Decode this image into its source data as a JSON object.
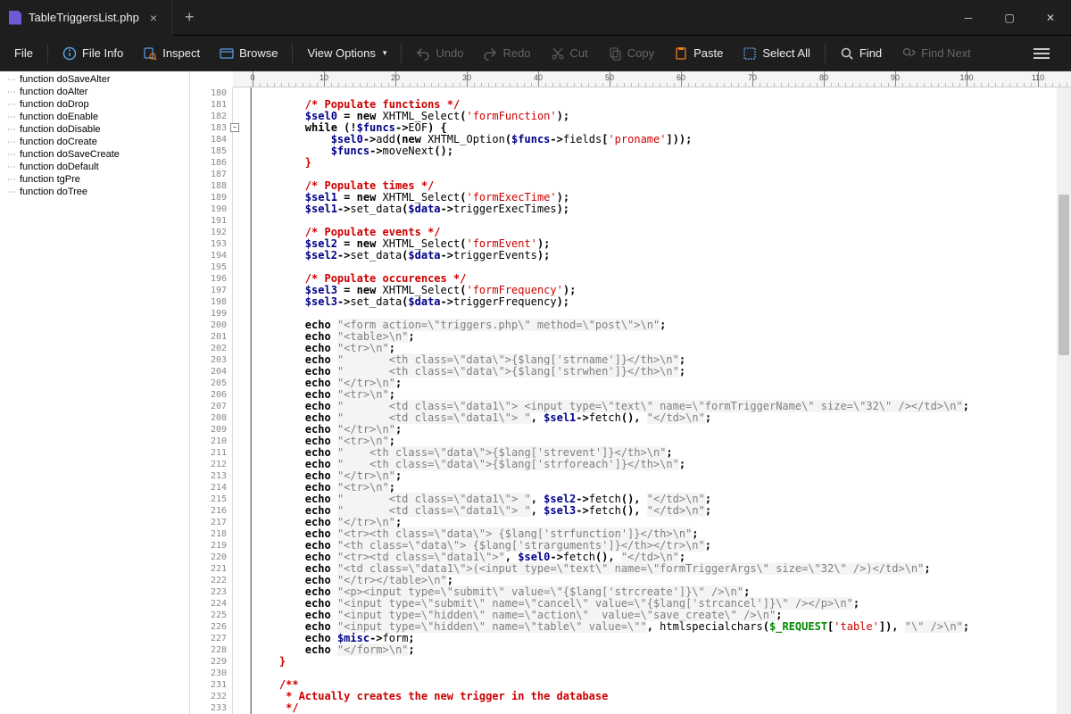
{
  "tab": {
    "title": "TableTriggersList.php"
  },
  "toolbar": {
    "file": "File",
    "file_info": "File Info",
    "inspect": "Inspect",
    "browse": "Browse",
    "view_options": "View Options",
    "undo": "Undo",
    "redo": "Redo",
    "cut": "Cut",
    "copy": "Copy",
    "paste": "Paste",
    "select_all": "Select All",
    "find": "Find",
    "find_next": "Find Next"
  },
  "outline": [
    "function doSaveAlter",
    "function doAlter",
    "function doDrop",
    "function doEnable",
    "function doDisable",
    "function doCreate",
    "function doSaveCreate",
    "function doDefault",
    "function tgPre",
    "function doTree"
  ],
  "ruler": {
    "start": 0,
    "step": 10,
    "count": 12,
    "charWidth": 8
  },
  "code": {
    "first_line": 180,
    "lines": [
      {
        "i": 180,
        "t": ""
      },
      {
        "i": 181,
        "t": "        /* Populate functions */",
        "cls": "cm"
      },
      {
        "i": 182,
        "h": "        <span class='vr'>$sel0</span> <span class='op'>=</span> <span class='kw'>new</span> XHTML_Select<span class='op'>(</span><span class='sq'>'formFunction'</span><span class='op'>);</span>"
      },
      {
        "i": 183,
        "h": "        <span class='kw'>while</span> <span class='op'>(!</span><span class='vr'>$funcs</span><span class='op'>-&gt;</span>EOF<span class='op'>) {</span>",
        "fold": true
      },
      {
        "i": 184,
        "h": "            <span class='vr'>$sel0</span><span class='op'>-&gt;</span>add<span class='op'>(</span><span class='kw'>new</span> XHTML_Option<span class='op'>(</span><span class='vr'>$funcs</span><span class='op'>-&gt;</span>fields<span class='op'>[</span><span class='sq'>'proname'</span><span class='op'>]));</span>"
      },
      {
        "i": 185,
        "h": "            <span class='vr'>$funcs</span><span class='op'>-&gt;</span>moveNext<span class='op'>();</span>"
      },
      {
        "i": 186,
        "h": "        <span class='br'>}</span>"
      },
      {
        "i": 187,
        "t": ""
      },
      {
        "i": 188,
        "t": "        /* Populate times */",
        "cls": "cm"
      },
      {
        "i": 189,
        "h": "        <span class='vr'>$sel1</span> <span class='op'>=</span> <span class='kw'>new</span> XHTML_Select<span class='op'>(</span><span class='sq'>'formExecTime'</span><span class='op'>);</span>"
      },
      {
        "i": 190,
        "h": "        <span class='vr'>$sel1</span><span class='op'>-&gt;</span>set_data<span class='op'>(</span><span class='vr'>$data</span><span class='op'>-&gt;</span>triggerExecTimes<span class='op'>);</span>"
      },
      {
        "i": 191,
        "t": ""
      },
      {
        "i": 192,
        "t": "        /* Populate events */",
        "cls": "cm"
      },
      {
        "i": 193,
        "h": "        <span class='vr'>$sel2</span> <span class='op'>=</span> <span class='kw'>new</span> XHTML_Select<span class='op'>(</span><span class='sq'>'formEvent'</span><span class='op'>);</span>"
      },
      {
        "i": 194,
        "h": "        <span class='vr'>$sel2</span><span class='op'>-&gt;</span>set_data<span class='op'>(</span><span class='vr'>$data</span><span class='op'>-&gt;</span>triggerEvents<span class='op'>);</span>"
      },
      {
        "i": 195,
        "t": ""
      },
      {
        "i": 196,
        "t": "        /* Populate occurences */",
        "cls": "cm"
      },
      {
        "i": 197,
        "h": "        <span class='vr'>$sel3</span> <span class='op'>=</span> <span class='kw'>new</span> XHTML_Select<span class='op'>(</span><span class='sq'>'formFrequency'</span><span class='op'>);</span>"
      },
      {
        "i": 198,
        "h": "        <span class='vr'>$sel3</span><span class='op'>-&gt;</span>set_data<span class='op'>(</span><span class='vr'>$data</span><span class='op'>-&gt;</span>triggerFrequency<span class='op'>);</span>"
      },
      {
        "i": 199,
        "t": ""
      },
      {
        "i": 200,
        "h": "        <span class='kw'>echo</span> <span class='st'>\"&lt;form action=\\\"triggers.php\\\" method=\\\"post\\\"&gt;\\n\"</span><span class='op'>;</span>"
      },
      {
        "i": 201,
        "h": "        <span class='kw'>echo</span> <span class='st'>\"&lt;table&gt;\\n\"</span><span class='op'>;</span>"
      },
      {
        "i": 202,
        "h": "        <span class='kw'>echo</span> <span class='st'>\"&lt;tr&gt;\\n\"</span><span class='op'>;</span>"
      },
      {
        "i": 203,
        "h": "        <span class='kw'>echo</span> <span class='st'>\"       &lt;th class=\\\"data\\\"&gt;{$lang['strname']}&lt;/th&gt;\\n\"</span><span class='op'>;</span>"
      },
      {
        "i": 204,
        "h": "        <span class='kw'>echo</span> <span class='st'>\"       &lt;th class=\\\"data\\\"&gt;{$lang['strwhen']}&lt;/th&gt;\\n\"</span><span class='op'>;</span>"
      },
      {
        "i": 205,
        "h": "        <span class='kw'>echo</span> <span class='st'>\"&lt;/tr&gt;\\n\"</span><span class='op'>;</span>"
      },
      {
        "i": 206,
        "h": "        <span class='kw'>echo</span> <span class='st'>\"&lt;tr&gt;\\n\"</span><span class='op'>;</span>"
      },
      {
        "i": 207,
        "h": "        <span class='kw'>echo</span> <span class='st'>\"       &lt;td class=\\\"data1\\\"&gt; &lt;input type=\\\"text\\\" name=\\\"formTriggerName\\\" size=\\\"32\\\" /&gt;&lt;/td&gt;\\n\"</span><span class='op'>;</span>"
      },
      {
        "i": 208,
        "h": "        <span class='kw'>echo</span> <span class='st'>\"       &lt;td class=\\\"data1\\\"&gt; \"</span><span class='op'>,</span> <span class='vr'>$sel1</span><span class='op'>-&gt;</span>fetch<span class='op'>(),</span> <span class='st'>\"&lt;/td&gt;\\n\"</span><span class='op'>;</span>"
      },
      {
        "i": 209,
        "h": "        <span class='kw'>echo</span> <span class='st'>\"&lt;/tr&gt;\\n\"</span><span class='op'>;</span>"
      },
      {
        "i": 210,
        "h": "        <span class='kw'>echo</span> <span class='st'>\"&lt;tr&gt;\\n\"</span><span class='op'>;</span>"
      },
      {
        "i": 211,
        "h": "        <span class='kw'>echo</span> <span class='st'>\"    &lt;th class=\\\"data\\\"&gt;{$lang['strevent']}&lt;/th&gt;\\n\"</span><span class='op'>;</span>"
      },
      {
        "i": 212,
        "h": "        <span class='kw'>echo</span> <span class='st'>\"    &lt;th class=\\\"data\\\"&gt;{$lang['strforeach']}&lt;/th&gt;\\n\"</span><span class='op'>;</span>"
      },
      {
        "i": 213,
        "h": "        <span class='kw'>echo</span> <span class='st'>\"&lt;/tr&gt;\\n\"</span><span class='op'>;</span>"
      },
      {
        "i": 214,
        "h": "        <span class='kw'>echo</span> <span class='st'>\"&lt;tr&gt;\\n\"</span><span class='op'>;</span>"
      },
      {
        "i": 215,
        "h": "        <span class='kw'>echo</span> <span class='st'>\"       &lt;td class=\\\"data1\\\"&gt; \"</span><span class='op'>,</span> <span class='vr'>$sel2</span><span class='op'>-&gt;</span>fetch<span class='op'>(),</span> <span class='st'>\"&lt;/td&gt;\\n\"</span><span class='op'>;</span>"
      },
      {
        "i": 216,
        "h": "        <span class='kw'>echo</span> <span class='st'>\"       &lt;td class=\\\"data1\\\"&gt; \"</span><span class='op'>,</span> <span class='vr'>$sel3</span><span class='op'>-&gt;</span>fetch<span class='op'>(),</span> <span class='st'>\"&lt;/td&gt;\\n\"</span><span class='op'>;</span>"
      },
      {
        "i": 217,
        "h": "        <span class='kw'>echo</span> <span class='st'>\"&lt;/tr&gt;\\n\"</span><span class='op'>;</span>"
      },
      {
        "i": 218,
        "h": "        <span class='kw'>echo</span> <span class='st'>\"&lt;tr&gt;&lt;th class=\\\"data\\\"&gt; {$lang['strfunction']}&lt;/th&gt;\\n\"</span><span class='op'>;</span>"
      },
      {
        "i": 219,
        "h": "        <span class='kw'>echo</span> <span class='st'>\"&lt;th class=\\\"data\\\"&gt; {$lang['strarguments']}&lt;/th&gt;&lt;/tr&gt;\\n\"</span><span class='op'>;</span>"
      },
      {
        "i": 220,
        "h": "        <span class='kw'>echo</span> <span class='st'>\"&lt;tr&gt;&lt;td class=\\\"data1\\\"&gt;\"</span><span class='op'>,</span> <span class='vr'>$sel0</span><span class='op'>-&gt;</span>fetch<span class='op'>(),</span> <span class='st'>\"&lt;/td&gt;\\n\"</span><span class='op'>;</span>"
      },
      {
        "i": 221,
        "h": "        <span class='kw'>echo</span> <span class='st'>\"&lt;td class=\\\"data1\\\"&gt;(&lt;input type=\\\"text\\\" name=\\\"formTriggerArgs\\\" size=\\\"32\\\" /&gt;)&lt;/td&gt;\\n\"</span><span class='op'>;</span>"
      },
      {
        "i": 222,
        "h": "        <span class='kw'>echo</span> <span class='st'>\"&lt;/tr&gt;&lt;/table&gt;\\n\"</span><span class='op'>;</span>"
      },
      {
        "i": 223,
        "h": "        <span class='kw'>echo</span> <span class='st'>\"&lt;p&gt;&lt;input type=\\\"submit\\\" value=\\\"{$lang['strcreate']}\\\" /&gt;\\n\"</span><span class='op'>;</span>"
      },
      {
        "i": 224,
        "h": "        <span class='kw'>echo</span> <span class='st'>\"&lt;input type=\\\"submit\\\" name=\\\"cancel\\\" value=\\\"{$lang['strcancel']}\\\" /&gt;&lt;/p&gt;\\n\"</span><span class='op'>;</span>"
      },
      {
        "i": 225,
        "h": "        <span class='kw'>echo</span> <span class='st'>\"&lt;input type=\\\"hidden\\\" name=\\\"action\\\"  value=\\\"save_create\\\" /&gt;\\n\"</span><span class='op'>;</span>"
      },
      {
        "i": 226,
        "h": "        <span class='kw'>echo</span> <span class='st'>\"&lt;input type=\\\"hidden\\\" name=\\\"table\\\" value=\\\"\"</span><span class='op'>,</span> htmlspecialchars<span class='op'>(</span><span class='vrg'>$_REQUEST</span><span class='op'>[</span><span class='sq'>'table'</span><span class='op'>]),</span> <span class='st'>\"\\\" /&gt;\\n\"</span><span class='op'>;</span>"
      },
      {
        "i": 227,
        "h": "        <span class='kw'>echo</span> <span class='vr'>$misc</span><span class='op'>-&gt;</span>form<span class='op'>;</span>"
      },
      {
        "i": 228,
        "h": "        <span class='kw'>echo</span> <span class='st'>\"&lt;/form&gt;\\n\"</span><span class='op'>;</span>"
      },
      {
        "i": 229,
        "h": "    <span class='br'>}</span>"
      },
      {
        "i": 230,
        "t": ""
      },
      {
        "i": 231,
        "t": "    /**",
        "cls": "cm"
      },
      {
        "i": 232,
        "t": "     * Actually creates the new trigger in the database",
        "cls": "cm"
      },
      {
        "i": 233,
        "t": "     */",
        "cls": "cm"
      }
    ]
  }
}
